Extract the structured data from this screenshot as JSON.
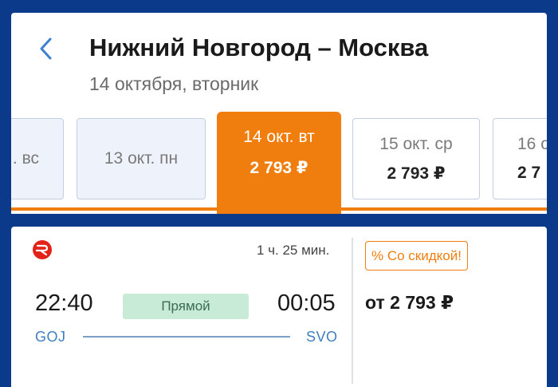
{
  "header": {
    "title": "Нижний Новгород – Москва",
    "subtitle": "14 октября, вторник"
  },
  "colors": {
    "accent": "#f07e0e",
    "background": "#0b3a8a",
    "link": "#3f7fc0",
    "badge_green": "#c7ebd7"
  },
  "date_strip": {
    "dates": [
      {
        "label": ". вс",
        "price": ""
      },
      {
        "label": "13 окт. пн",
        "price": ""
      },
      {
        "label": "14 окт. вт",
        "price": "2 793 ₽",
        "selected": true
      },
      {
        "label": "15 окт. ср",
        "price": "2 793 ₽"
      },
      {
        "label": "16 о",
        "price": "2 7"
      }
    ]
  },
  "result": {
    "carrier_icon": "rzd-logo-icon",
    "duration": "1 ч. 25 мин.",
    "departure_time": "22:40",
    "arrival_time": "00:05",
    "route_type": "Прямой",
    "departure_code": "GOJ",
    "arrival_code": "SVO",
    "discount_label": "% Со скидкой!",
    "price": "от 2 793 ₽"
  }
}
